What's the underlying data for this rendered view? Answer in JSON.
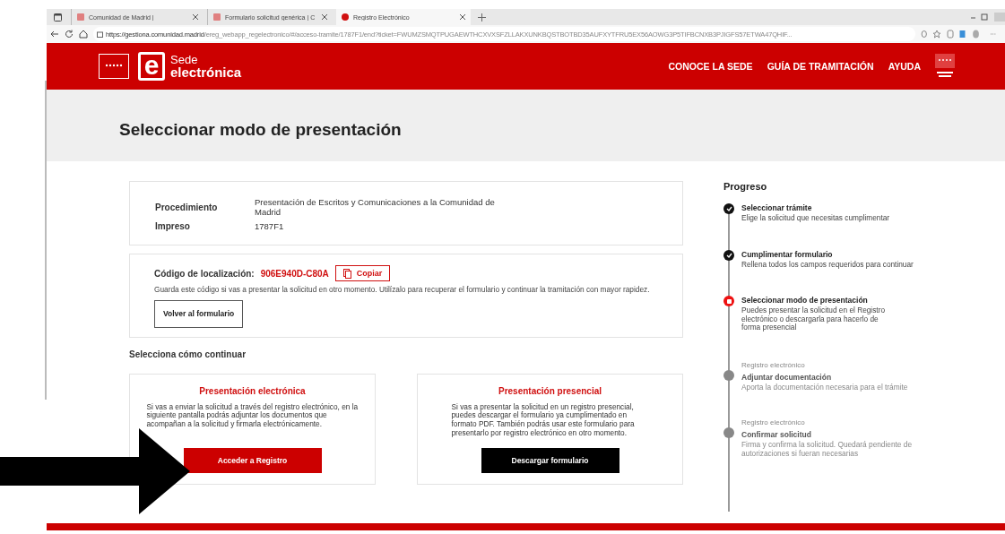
{
  "browser": {
    "tabs": [
      {
        "label": "Comunidad de Madrid |",
        "selected": false
      },
      {
        "label": "Formulario solicitud genérica | C",
        "selected": false
      },
      {
        "label": "Registro Electrónico",
        "selected": true
      }
    ],
    "url_host": "https://gestiona.comunidad.madrid",
    "url_path": "/ereg_webapp_regelectronico/#/acceso-tramite/1787F1/end?ticket=FWUMZSMQTPUGAEWTHCXVXSFZLLAKXUNKBQSTBOTBD35AUFXYTFRU5EX56AOWG3P5TIFBCNXB3PJIGFS57ETWA47QHIF..."
  },
  "header": {
    "brand_top": "Sede",
    "brand_bottom": "electrónica",
    "logo_letter": "e",
    "nav": [
      "CONOCE LA SEDE",
      "GUÍA DE TRAMITACIÓN",
      "AYUDA"
    ]
  },
  "page_title": "Seleccionar modo de presentación",
  "summary": [
    {
      "label": "Procedimiento",
      "value": "Presentación de Escritos y Comunicaciones a la Comunidad de Madrid"
    },
    {
      "label": "Impreso",
      "value": "1787F1"
    }
  ],
  "locator": {
    "label": "Código de localización:",
    "code": "906E940D-C80A",
    "copy_button": "Copiar",
    "note": "Guarda este código si vas a presentar la solicitud en otro momento. Utilízalo para recuperar el formulario y continuar la tramitación con mayor rapidez.",
    "back_button": "Volver al formulario"
  },
  "continue_heading": "Selecciona cómo continuar",
  "options": [
    {
      "title": "Presentación electrónica",
      "text": "Si vas a enviar la solicitud a través del registro electrónico, en la siguiente pantalla podrás adjuntar los documentos que acompañan a la solicitud y firmarla electrónicamente.",
      "button": "Acceder a Registro",
      "kind": "primary"
    },
    {
      "title": "Presentación presencial",
      "text": "Si vas a presentar la solicitud en un registro presencial, puedes descargar el formulario ya cumplimentado en formato PDF. También podrás usar este formulario para presentarlo por registro electrónico en otro momento.",
      "button": "Descargar formulario",
      "kind": "dark"
    }
  ],
  "progress": {
    "title": "Progreso",
    "steps": [
      {
        "kind": "done",
        "title": "Seleccionar trámite",
        "text": "Elige la solicitud que necesitas cumplimentar"
      },
      {
        "kind": "done",
        "title": "Cumplimentar formulario",
        "text": "Rellena todos los campos requeridos para continuar"
      },
      {
        "kind": "current",
        "title": "Seleccionar modo de presentación",
        "text": "Puedes presentar la solicitud en el Registro electrónico o descargarla para hacerlo de forma presencial"
      },
      {
        "kind": "pending",
        "phase": "Registro electrónico",
        "title": "Adjuntar documentación",
        "text": "Aporta la documentación necesaria para el trámite"
      },
      {
        "kind": "pending",
        "phase": "Registro electrónico",
        "title": "Confirmar solicitud",
        "text": "Firma y confirma la solicitud. Quedará pendiente de autorizaciones si fueran necesarias"
      }
    ]
  }
}
